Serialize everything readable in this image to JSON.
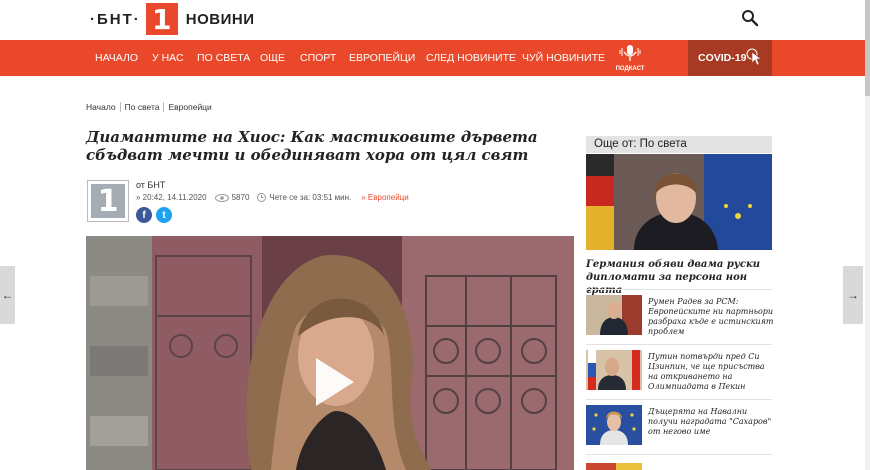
{
  "header": {
    "logo_bnt": "·БНТ·",
    "logo_one": "1",
    "logo_news": "НОВИНИ",
    "search_icon": "search-icon"
  },
  "nav": {
    "items": [
      "НАЧАЛО",
      "У НАС",
      "ПО СВЕТА",
      "ОЩЕ",
      "СПОРТ",
      "ЕВРОПЕЙЦИ",
      "СЛЕД НОВИНИТЕ",
      "ЧУЙ НОВИНИТЕ"
    ],
    "podcast": "ПОДКАСТ",
    "covid": "COVID-19",
    "accent": "#e9492a",
    "covid_bg": "#a63a23"
  },
  "breadcrumb": [
    "Начало",
    "По света",
    "Европейци"
  ],
  "article": {
    "title": "Диамантите на Хиос: Как мастиковите дървета сбъдват мечти и обединяват хора от цял свят",
    "author": "от БНТ",
    "date": "» 20:42, 14.11.2020",
    "views": "5870",
    "read_time": "Чете се за: 03:51 мин.",
    "category": "» Европейци",
    "avatar_text": "1",
    "share_fb": "f",
    "share_tw": "t"
  },
  "sidebar": {
    "heading": "Още от: По света",
    "featured_caption": "Германия обяви двама руски дипломати за персона нон грата",
    "items": [
      {
        "text": "Румен Радев за РСМ: Европейските ни партньори разбраха къде е истинският проблем"
      },
      {
        "text": "Путин потвърди пред Си Цзинпин, че ще присъства на откриването на Олимпиадата в Пекин"
      },
      {
        "text": "Дъщерята на Навални получи наградата \"Сахаров\" от негово име"
      }
    ]
  }
}
